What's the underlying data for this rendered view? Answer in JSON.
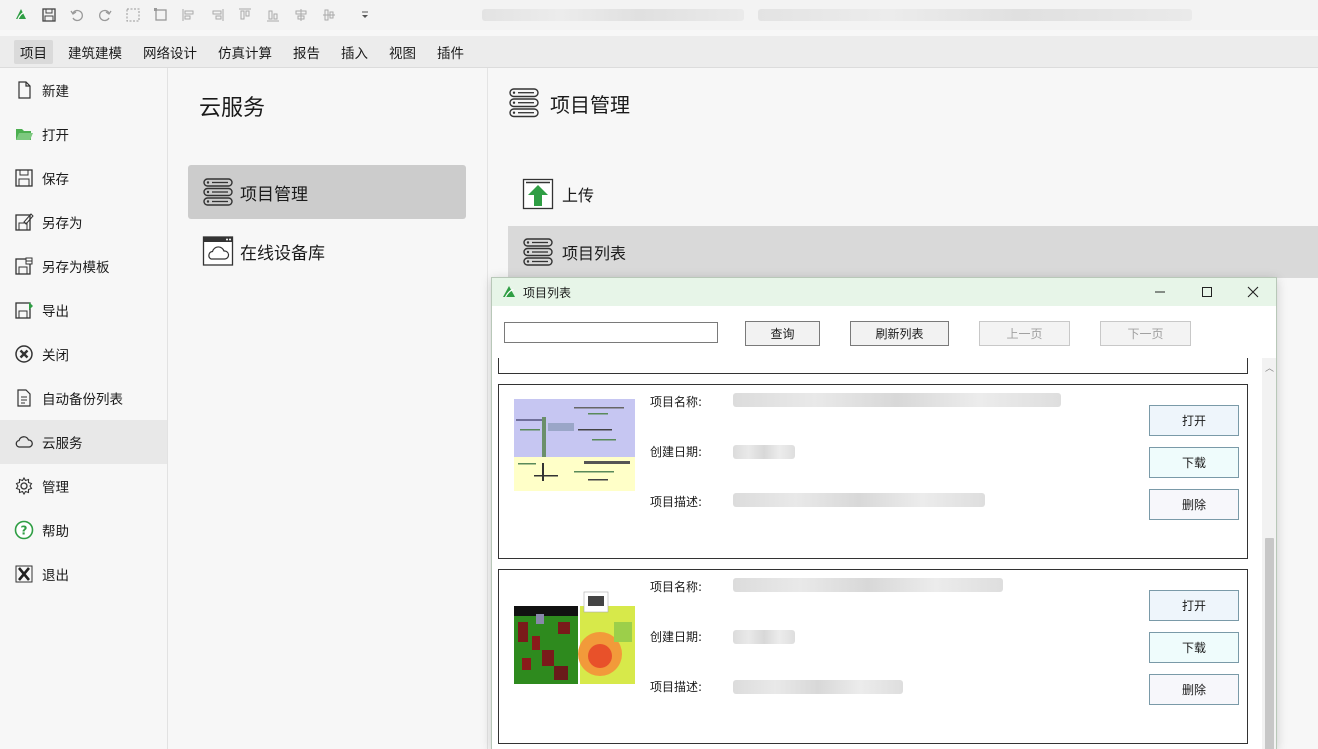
{
  "menubar": {
    "items": [
      "项目",
      "建筑建模",
      "网络设计",
      "仿真计算",
      "报告",
      "插入",
      "视图",
      "插件"
    ],
    "active": 0
  },
  "sidebar": {
    "items": [
      {
        "label": "新建",
        "icon": "new-file-icon"
      },
      {
        "label": "打开",
        "icon": "open-folder-icon"
      },
      {
        "label": "保存",
        "icon": "save-icon"
      },
      {
        "label": "另存为",
        "icon": "save-as-icon"
      },
      {
        "label": "另存为模板",
        "icon": "save-template-icon"
      },
      {
        "label": "导出",
        "icon": "export-icon"
      },
      {
        "label": "关闭",
        "icon": "close-circle-icon"
      },
      {
        "label": "自动备份列表",
        "icon": "backup-list-icon"
      },
      {
        "label": "云服务",
        "icon": "cloud-icon"
      },
      {
        "label": "管理",
        "icon": "gear-icon"
      },
      {
        "label": "帮助",
        "icon": "help-icon"
      },
      {
        "label": "退出",
        "icon": "exit-icon"
      }
    ],
    "active": 8
  },
  "middle": {
    "title": "云服务",
    "items": [
      {
        "label": "项目管理",
        "icon": "server-list-icon"
      },
      {
        "label": "在线设备库",
        "icon": "cloud-window-icon"
      }
    ],
    "active": 0
  },
  "right": {
    "title": "项目管理",
    "rows": [
      {
        "label": "上传",
        "icon": "upload-arrow-icon"
      },
      {
        "label": "项目列表",
        "icon": "server-list-icon"
      }
    ],
    "active": 1
  },
  "dialog": {
    "title": "项目列表",
    "search": {
      "value": "",
      "placeholder": ""
    },
    "buttons": {
      "query": "查询",
      "refresh": "刷新列表",
      "prev": "上一页",
      "next": "下一页"
    },
    "labels": {
      "name": "项目名称:",
      "date": "创建日期:",
      "desc": "项目描述:"
    },
    "card_buttons": {
      "open": "打开",
      "download": "下载",
      "delete": "删除"
    }
  }
}
